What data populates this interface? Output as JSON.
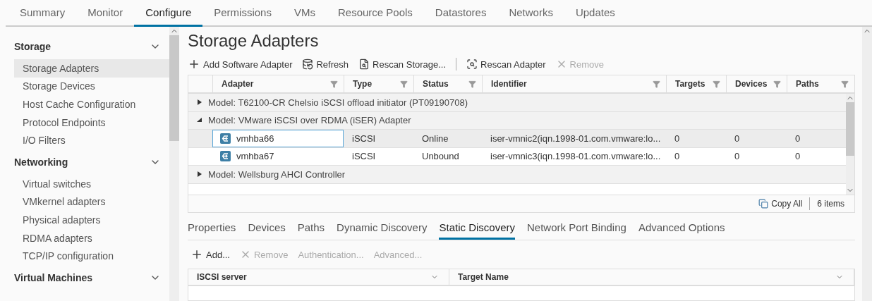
{
  "top_tabs": [
    {
      "label": "Summary",
      "selected": false
    },
    {
      "label": "Monitor",
      "selected": false
    },
    {
      "label": "Configure",
      "selected": true
    },
    {
      "label": "Permissions",
      "selected": false
    },
    {
      "label": "VMs",
      "selected": false
    },
    {
      "label": "Resource Pools",
      "selected": false
    },
    {
      "label": "Datastores",
      "selected": false
    },
    {
      "label": "Networks",
      "selected": false
    },
    {
      "label": "Updates",
      "selected": false
    }
  ],
  "sidebar": {
    "sections": [
      {
        "title": "Storage",
        "expanded": true,
        "items": [
          {
            "label": "Storage Adapters",
            "selected": true
          },
          {
            "label": "Storage Devices",
            "selected": false
          },
          {
            "label": "Host Cache Configuration",
            "selected": false
          },
          {
            "label": "Protocol Endpoints",
            "selected": false
          },
          {
            "label": "I/O Filters",
            "selected": false
          }
        ]
      },
      {
        "title": "Networking",
        "expanded": true,
        "items": [
          {
            "label": "Virtual switches",
            "selected": false
          },
          {
            "label": "VMkernel adapters",
            "selected": false
          },
          {
            "label": "Physical adapters",
            "selected": false
          },
          {
            "label": "RDMA adapters",
            "selected": false
          },
          {
            "label": "TCP/IP configuration",
            "selected": false
          }
        ]
      },
      {
        "title": "Virtual Machines",
        "expanded": true
      }
    ]
  },
  "page_title": "Storage Adapters",
  "toolbar": [
    {
      "kind": "add",
      "label": "Add Software Adapter",
      "disabled": false
    },
    {
      "kind": "refresh",
      "label": "Refresh",
      "disabled": false
    },
    {
      "kind": "rescan-storage",
      "label": "Rescan Storage...",
      "disabled": false
    },
    {
      "kind": "separator"
    },
    {
      "kind": "rescan-adapter",
      "label": "Rescan Adapter",
      "disabled": false
    },
    {
      "kind": "remove",
      "label": "Remove",
      "disabled": true
    }
  ],
  "table": {
    "columns": [
      "Adapter",
      "Type",
      "Status",
      "Identifier",
      "Targets",
      "Devices",
      "Paths"
    ],
    "groups": [
      {
        "label": "Model: T62100-CR Chelsio iSCSI offload initiator (PT09190708)",
        "expanded": false
      },
      {
        "label": "Model: VMware iSCSI over RDMA (iSER) Adapter",
        "expanded": true,
        "rows": [
          {
            "cells": [
              "vmhba66",
              "iSCSI",
              "Online",
              "iser-vmnic2(iqn.1998-01.com.vmware:lo...",
              "0",
              "0",
              "0"
            ],
            "selected": true
          },
          {
            "cells": [
              "vmhba67",
              "iSCSI",
              "Unbound",
              "iser-vmnic3(iqn.1998-01.com.vmware:lo...",
              "0",
              "0",
              "0"
            ],
            "selected": false
          }
        ]
      },
      {
        "label": "Model: Wellsburg AHCI Controller",
        "expanded": false
      }
    ],
    "footer": {
      "copy_label": "Copy All",
      "count": "6 items"
    }
  },
  "detail_tabs": [
    {
      "label": "Properties",
      "selected": false
    },
    {
      "label": "Devices",
      "selected": false
    },
    {
      "label": "Paths",
      "selected": false
    },
    {
      "label": "Dynamic Discovery",
      "selected": false
    },
    {
      "label": "Static Discovery",
      "selected": true
    },
    {
      "label": "Network Port Binding",
      "selected": false
    },
    {
      "label": "Advanced Options",
      "selected": false
    }
  ],
  "detail_toolbar": [
    {
      "kind": "add",
      "label": "Add...",
      "disabled": false
    },
    {
      "kind": "remove",
      "label": "Remove",
      "disabled": true
    },
    {
      "kind": "text",
      "label": "Authentication...",
      "disabled": true
    },
    {
      "kind": "text",
      "label": "Advanced...",
      "disabled": true
    }
  ],
  "detail_table": {
    "columns": [
      "ISCSI server",
      "Target Name"
    ]
  }
}
